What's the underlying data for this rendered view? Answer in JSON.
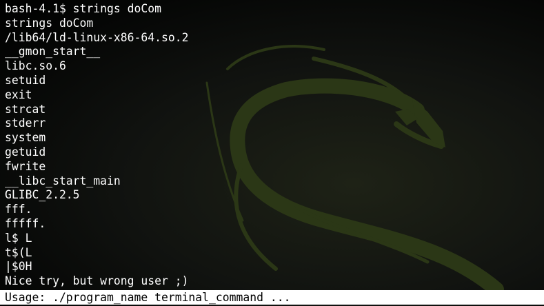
{
  "terminal": {
    "lines": [
      "bash-4.1$ strings doCom",
      "strings doCom",
      "/lib64/ld-linux-x86-64.so.2",
      "__gmon_start__",
      "libc.so.6",
      "setuid",
      "exit",
      "strcat",
      "stderr",
      "system",
      "getuid",
      "fwrite",
      "__libc_start_main",
      "GLIBC_2.2.5",
      "fff.",
      "fffff.",
      "l$ L",
      "t$(L",
      "|$0H",
      "Nice try, but wrong user ;)"
    ],
    "highlighted_line": "Usage: ./program_name terminal_command ..."
  },
  "colors": {
    "background": "#000000",
    "text": "#ffffff",
    "selection_background": "#ffffff",
    "selection_text": "#000000",
    "wallpaper_dragon": "#2b3716"
  },
  "icons": {
    "wallpaper": "kali-dragon-icon"
  }
}
